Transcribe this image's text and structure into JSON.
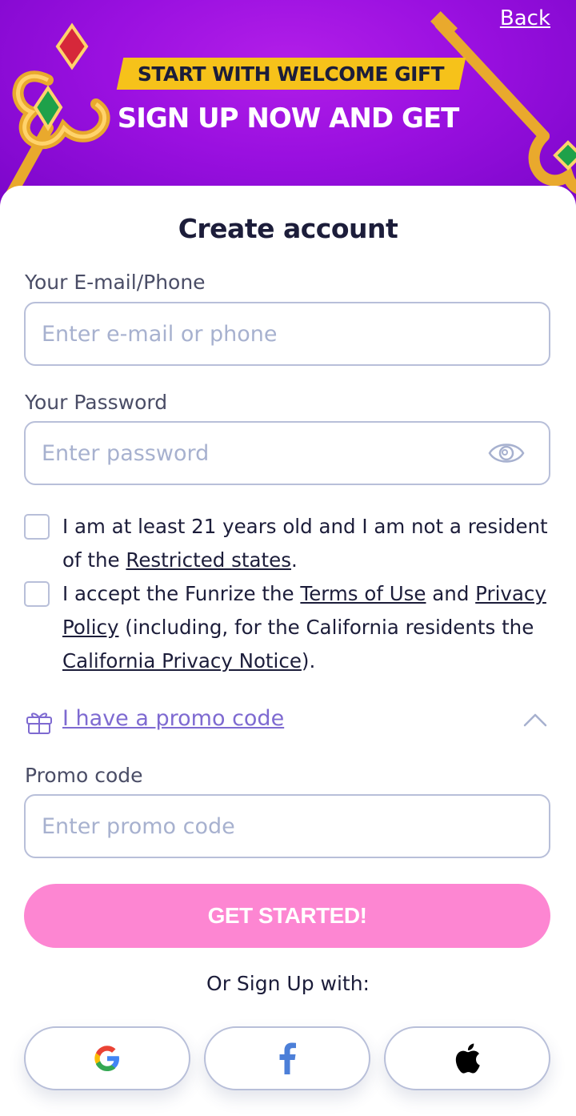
{
  "header": {
    "back_label": "Back",
    "ribbon_text": "START WITH WELCOME GIFT",
    "banner_title": "SIGN UP NOW AND GET"
  },
  "form": {
    "title": "Create account",
    "email": {
      "label": "Your E-mail/Phone",
      "placeholder": "Enter e-mail or phone",
      "value": ""
    },
    "password": {
      "label": "Your Password",
      "placeholder": "Enter password",
      "value": ""
    },
    "age_check": {
      "checked": false,
      "text_before": "I am at least 21 years old and I am not a resident of the ",
      "link_restricted": "Restricted states",
      "text_after": "."
    },
    "terms_check": {
      "checked": false,
      "text_before": "I accept the Funrize the ",
      "link_terms": "Terms of Use",
      "text_and": " and ",
      "link_privacy": "Privacy Policy",
      "text_mid": " (including, for the California residents the ",
      "link_california": "California Privacy Notice",
      "text_after": ")."
    },
    "promo": {
      "toggle_label": "I have a promo code",
      "label": "Promo code",
      "placeholder": "Enter promo code",
      "value": ""
    },
    "submit_label": "GET STARTED!",
    "or_text": "Or Sign Up with:",
    "social": [
      "google",
      "facebook",
      "apple"
    ]
  },
  "colors": {
    "banner": "#9a10e0",
    "ribbon": "#f6c21a",
    "cta": "#fd86d2",
    "promo_link": "#7e6ad1",
    "input_border": "#b8bfd9",
    "placeholder": "#a7b1cf"
  },
  "icons": {
    "password_toggle": "eye-icon",
    "promo": "gift-icon",
    "promo_collapse": "chevron-up-icon",
    "social": [
      "google-icon",
      "facebook-icon",
      "apple-icon"
    ]
  }
}
